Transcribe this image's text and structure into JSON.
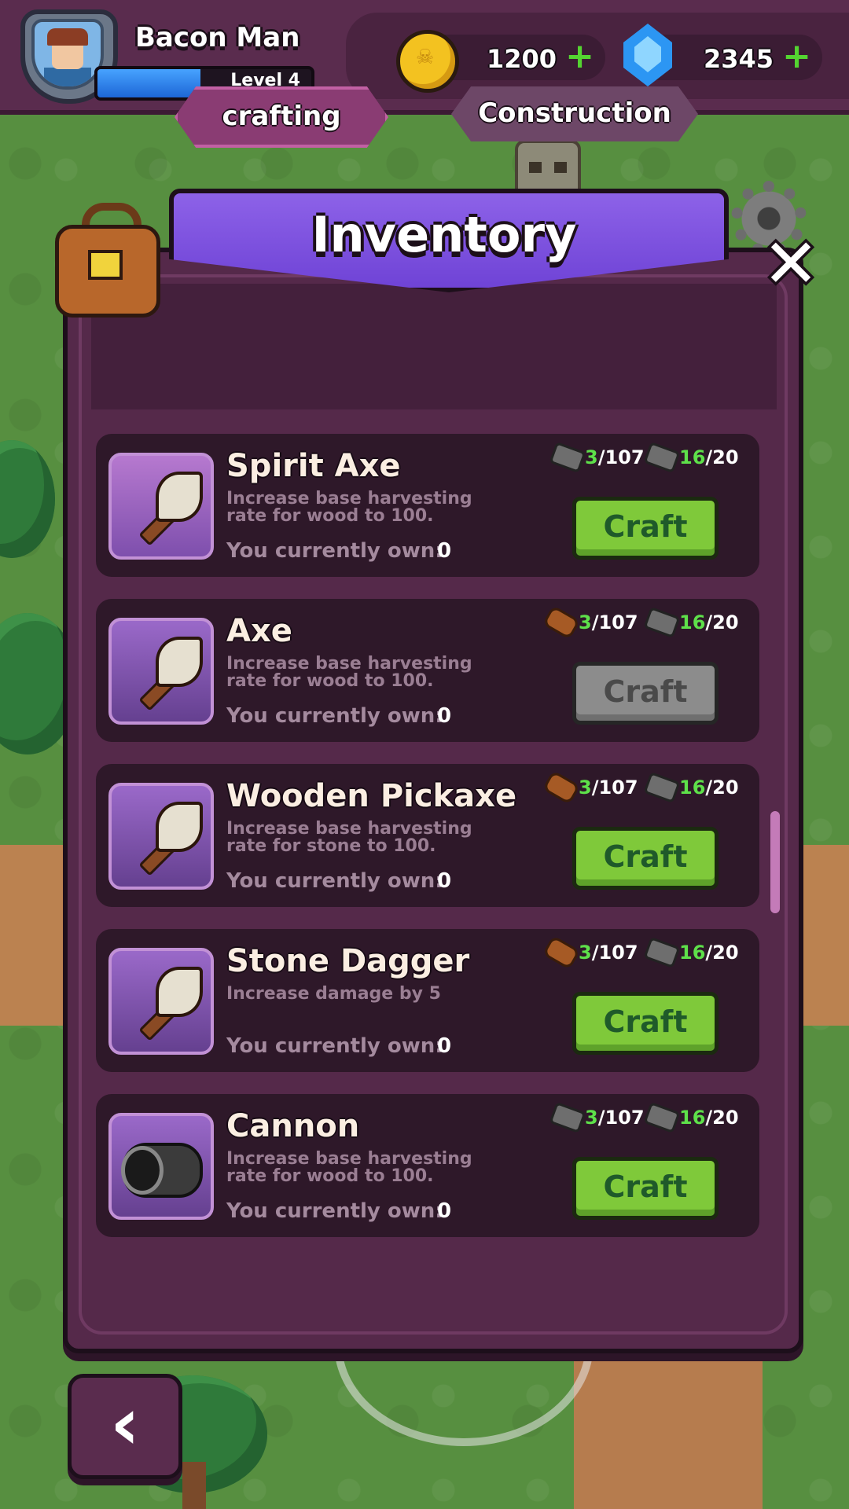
{
  "player": {
    "name": "Bacon Man",
    "level_label": "Level 4",
    "xp_fraction": 0.48
  },
  "currency": {
    "coins": {
      "value": "1200",
      "icon": "coin-icon"
    },
    "gems": {
      "value": "2345",
      "icon": "gem-icon"
    },
    "plus_glyph": "+"
  },
  "modal": {
    "title": "Inventory",
    "close_glyph": "✕",
    "tabs": [
      {
        "label": "crafting",
        "active": true
      },
      {
        "label": "Construction",
        "active": false
      }
    ]
  },
  "own_label": "You currently own:",
  "items": [
    {
      "name": "Spirit Axe",
      "description": "Increase base harvesting rate for wood to 100.",
      "owned": "0",
      "req1": {
        "icon": "stone",
        "have": "3",
        "need": "/107"
      },
      "req2": {
        "icon": "stone",
        "have": "16",
        "need": "/20"
      },
      "button": "Craft",
      "enabled": true
    },
    {
      "name": "Axe",
      "description": "Increase base harvesting rate for wood to 100.",
      "owned": "0",
      "req1": {
        "icon": "wood",
        "have": "3",
        "need": "/107"
      },
      "req2": {
        "icon": "stone",
        "have": "16",
        "need": "/20"
      },
      "button": "Craft",
      "enabled": false
    },
    {
      "name": "Wooden Pickaxe",
      "description": "Increase base harvesting rate for stone to 100.",
      "owned": "0",
      "req1": {
        "icon": "wood",
        "have": "3",
        "need": "/107"
      },
      "req2": {
        "icon": "stone",
        "have": "16",
        "need": "/20"
      },
      "button": "Craft",
      "enabled": true
    },
    {
      "name": "Stone Dagger",
      "description": "Increase damage by 5",
      "owned": "0",
      "req1": {
        "icon": "wood",
        "have": "3",
        "need": "/107"
      },
      "req2": {
        "icon": "stone",
        "have": "16",
        "need": "/20"
      },
      "button": "Craft",
      "enabled": true
    },
    {
      "name": "Cannon",
      "description": "Increase base harvesting rate for wood to 100.",
      "owned": "0",
      "req1": {
        "icon": "stone",
        "have": "3",
        "need": "/107"
      },
      "req2": {
        "icon": "stone",
        "have": "16",
        "need": "/20"
      },
      "button": "Craft",
      "enabled": true
    }
  ],
  "back_glyph": "‹",
  "colors": {
    "accent_green": "#7fc93a",
    "banner_purple": "#7b4fe0",
    "panel": "#55294a"
  }
}
